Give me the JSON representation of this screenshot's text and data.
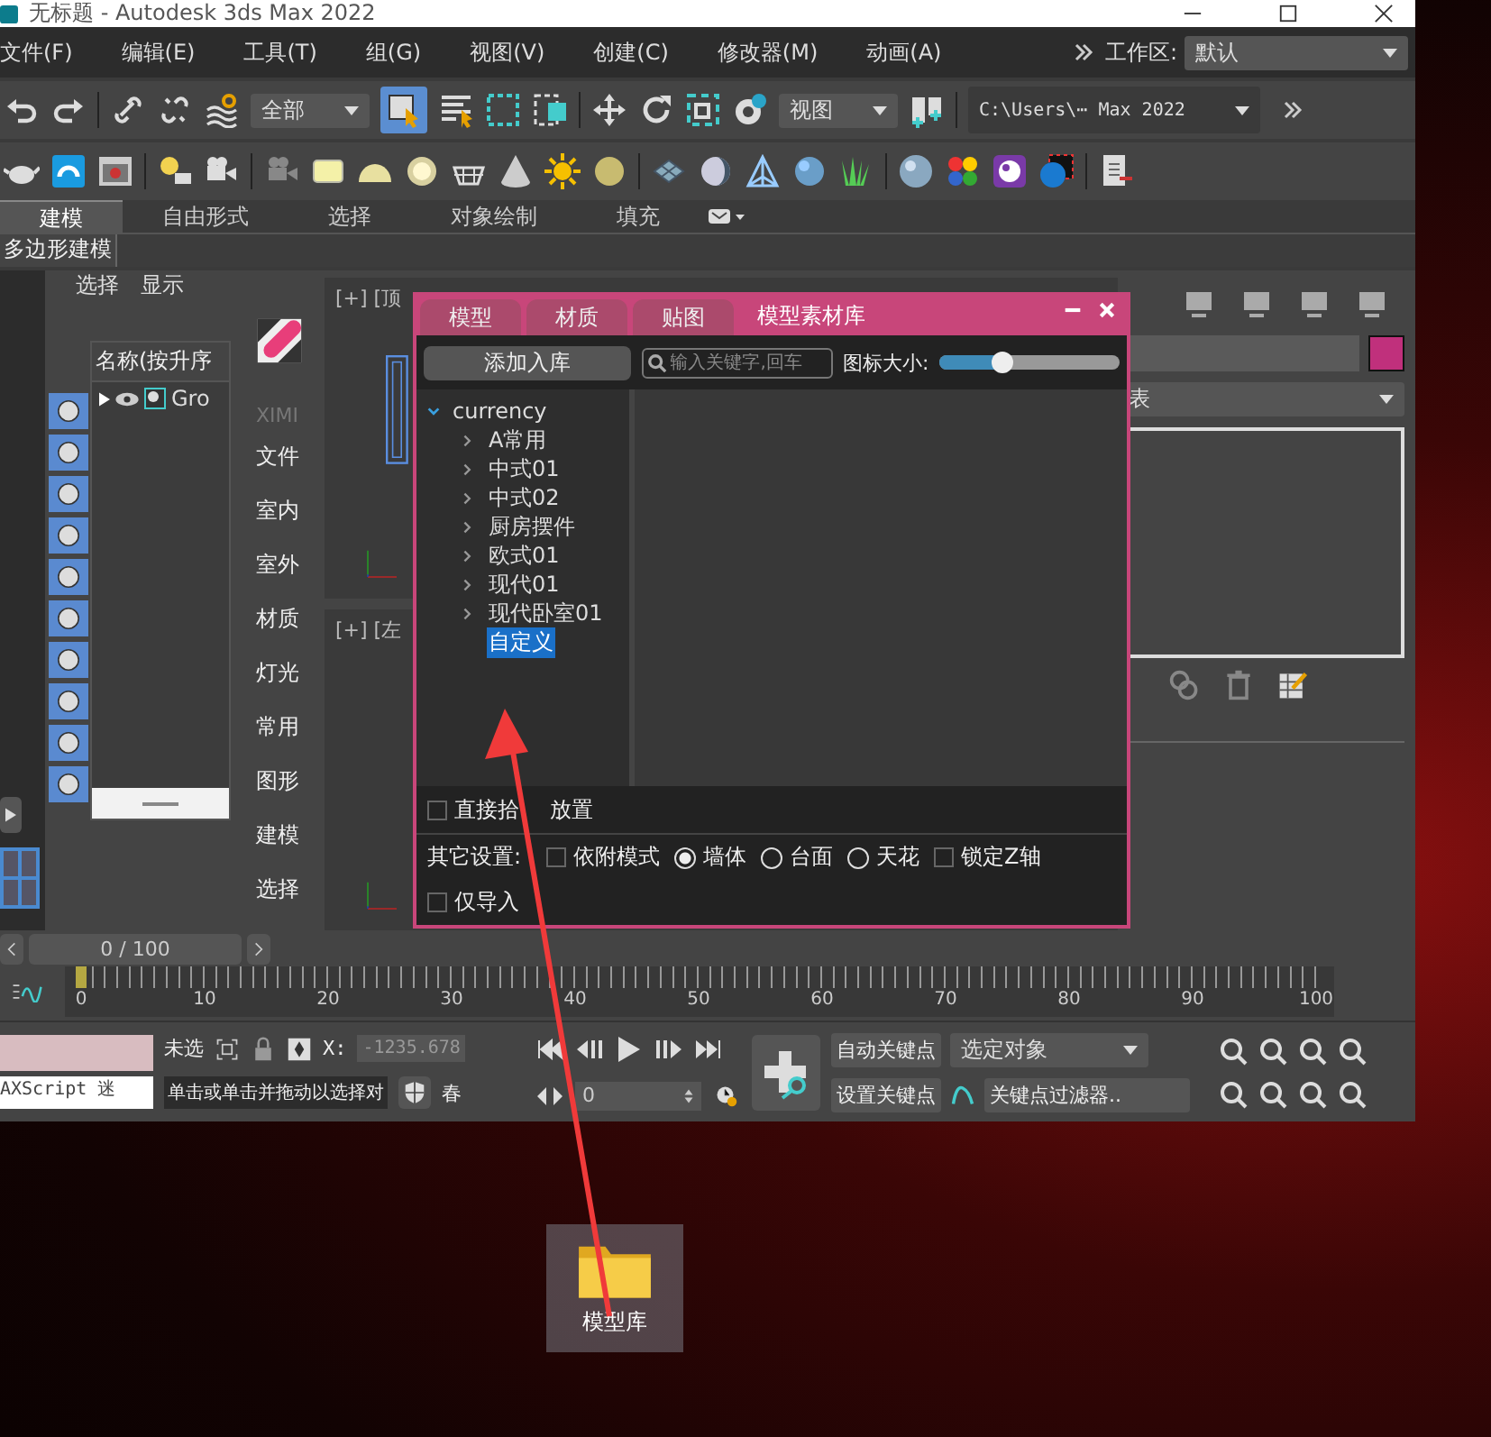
{
  "window": {
    "title": "无标题 - Autodesk 3ds Max 2022"
  },
  "menu": [
    "文件(F)",
    "编辑(E)",
    "工具(T)",
    "组(G)",
    "视图(V)",
    "创建(C)",
    "修改器(M)",
    "动画(A)"
  ],
  "workspace": {
    "label": "工作区:",
    "value": "默认"
  },
  "toolbar": {
    "selection_filter": "全部",
    "reference_coordinate": "视图",
    "project_path": "C:\\Users\\⋯ Max 2022"
  },
  "ribbon_tabs": [
    {
      "label": "建模",
      "selected": true
    },
    {
      "label": "自由形式",
      "selected": false
    },
    {
      "label": "选择",
      "selected": false
    },
    {
      "label": "对象绘制",
      "selected": false
    },
    {
      "label": "填充",
      "selected": false
    }
  ],
  "ribbon_panel": "多边形建模",
  "scene_explorer": {
    "tabs": [
      "选择",
      "显示"
    ],
    "column": "名称(按升序",
    "row": "Gro"
  },
  "plugin_menu": {
    "brand": "XIMI",
    "items": [
      "文件",
      "室内",
      "室外",
      "材质",
      "灯光",
      "常用",
      "图形",
      "建模",
      "选择"
    ]
  },
  "viewports": [
    "[+] [顶",
    "[+] [左"
  ],
  "command_panel": {
    "dropdown": "表"
  },
  "dialog": {
    "tabs": [
      {
        "label": "模型",
        "selected": false
      },
      {
        "label": "材质",
        "selected": false
      },
      {
        "label": "贴图",
        "selected": false
      },
      {
        "label": "模型素材库",
        "selected": true
      }
    ],
    "add_button": "添加入库",
    "search": {
      "placeholder": "输入关键字,回车"
    },
    "icon_size": {
      "label": "图标大小:",
      "level": 0.35
    },
    "tree": {
      "label": "currency",
      "expanded": true,
      "children": [
        {
          "label": "A常用",
          "kind": "folder",
          "selected": false
        },
        {
          "label": "中式01",
          "kind": "folder",
          "selected": false
        },
        {
          "label": "中式02",
          "kind": "folder",
          "selected": false
        },
        {
          "label": "厨房摆件",
          "kind": "folder",
          "selected": false
        },
        {
          "label": "欧式01",
          "kind": "folder",
          "selected": false
        },
        {
          "label": "现代01",
          "kind": "folder",
          "selected": false
        },
        {
          "label": "现代卧室01",
          "kind": "folder",
          "selected": false
        },
        {
          "label": "自定义",
          "kind": "leaf",
          "selected": true
        }
      ]
    },
    "direct_pick": {
      "label_parts": [
        "直接拾",
        "放置"
      ],
      "checked": false
    },
    "other_settings": {
      "label": "其它设置:",
      "attach_mode": {
        "label": "依附模式",
        "checked": false
      },
      "placement": [
        {
          "label": "墙体",
          "selected": true
        },
        {
          "label": "台面",
          "selected": false
        },
        {
          "label": "天花",
          "selected": false
        }
      ],
      "lock_z": {
        "label": "锁定Z轴",
        "checked": false
      }
    },
    "import_only": {
      "label": "仅导入",
      "checked": false
    }
  },
  "timeline": {
    "frame": "0 / 100",
    "labels": [
      "0",
      "10",
      "20",
      "30",
      "40",
      "50",
      "60",
      "70",
      "80",
      "90",
      "100"
    ]
  },
  "status": {
    "maxscript": "AXScript 迷",
    "selection": "未选",
    "x_label": "X:",
    "x_value": "-1235.678",
    "prompt": "单击或单击并拖动以选择对",
    "grid": "春",
    "current_frame": "0",
    "auto_key": "自动关键点",
    "key_mode": "选定对象",
    "set_key": "设置关键点",
    "key_filters": "关键点过滤器.."
  },
  "desktop_icon": {
    "label": "模型库"
  }
}
